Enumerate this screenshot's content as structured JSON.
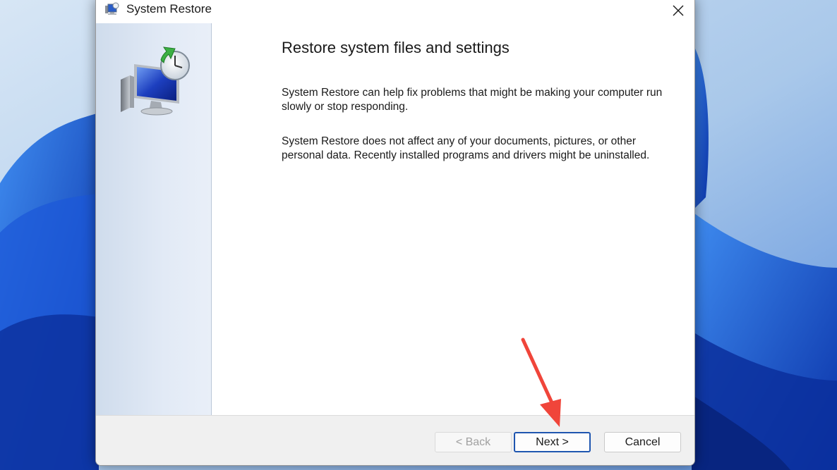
{
  "window": {
    "title": "System Restore",
    "title_icon": "system-restore-icon",
    "close_icon": "close-icon"
  },
  "sidepanel": {
    "icon": "system-restore-monitor-clock-icon"
  },
  "content": {
    "heading": "Restore system files and settings",
    "paragraph1": "System Restore can help fix problems that might be making your computer run slowly or stop responding.",
    "paragraph2": "System Restore does not affect any of your documents, pictures, or other personal data. Recently installed programs and drivers might be uninstalled."
  },
  "footer": {
    "back_label": "< Back",
    "next_label": "Next >",
    "cancel_label": "Cancel"
  },
  "annotation": {
    "arrow_color": "#f0453a"
  },
  "colors": {
    "accent": "#1f56b0",
    "wallpaper": "#0f3fb5"
  }
}
